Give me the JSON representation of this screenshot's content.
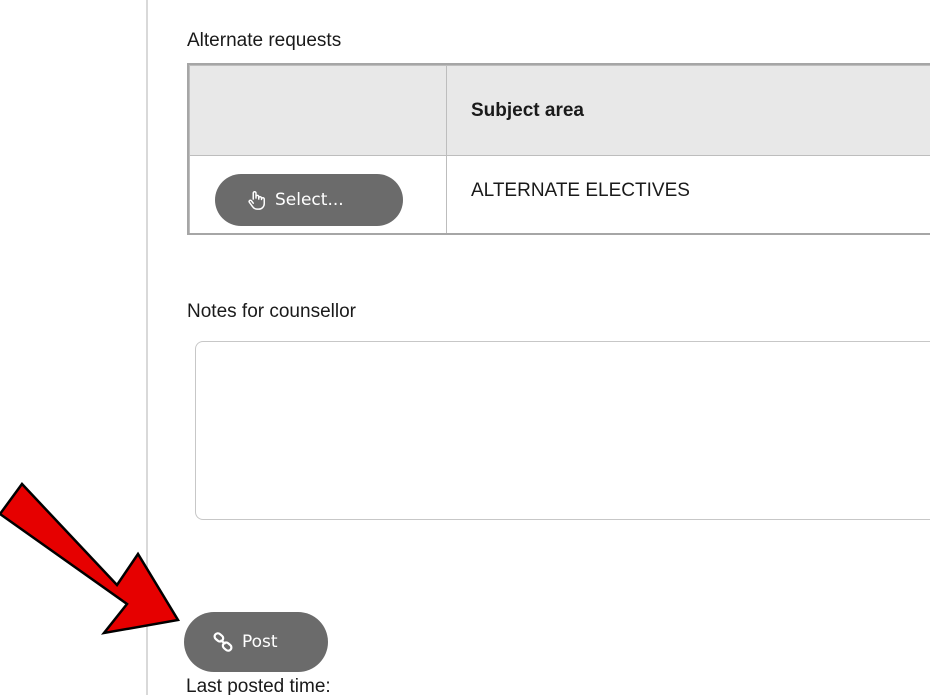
{
  "alternate_requests": {
    "label": "Alternate requests",
    "columns": [
      "",
      "Subject area"
    ],
    "rows": [
      {
        "action_label": "Select...",
        "subject_area": "ALTERNATE ELECTIVES"
      }
    ]
  },
  "notes": {
    "label": "Notes for counsellor",
    "value": ""
  },
  "post": {
    "label": "Post",
    "last_posted_label": "Last posted time:"
  },
  "icons": {
    "select": "hand-pointer-icon",
    "post": "link-icon"
  },
  "colors": {
    "button_bg": "#6b6b6b",
    "header_bg": "#e8e8e8",
    "annotation_arrow": "#e60000"
  }
}
